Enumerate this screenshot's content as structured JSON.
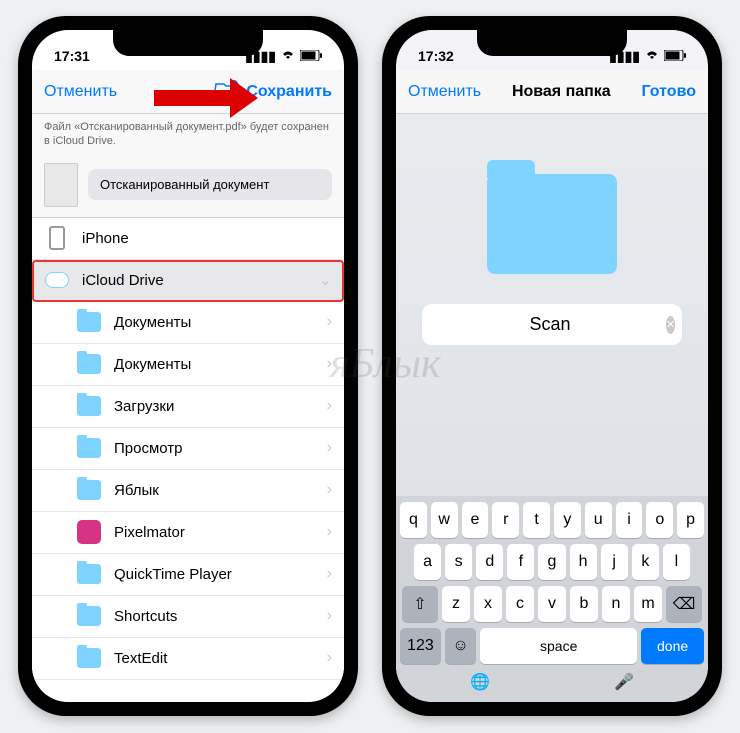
{
  "watermark": "яБлык",
  "left": {
    "status": {
      "time": "17:31"
    },
    "nav": {
      "cancel": "Отменить",
      "save": "Сохранить"
    },
    "subtext": "Файл «Отсканированный документ.pdf» будет сохранен в iCloud Drive.",
    "doc_name": "Отсканированный документ",
    "locations": {
      "iphone": "iPhone",
      "icloud": "iCloud Drive"
    },
    "folders": [
      "Документы",
      "Документы",
      "Загрузки",
      "Просмотр",
      "Яблык",
      "Pixelmator",
      "QuickTime Player",
      "Shortcuts",
      "TextEdit"
    ]
  },
  "right": {
    "status": {
      "time": "17:32"
    },
    "nav": {
      "cancel": "Отменить",
      "title": "Новая папка",
      "done": "Готово"
    },
    "input": {
      "value": "Scan"
    },
    "keyboard": {
      "row1": [
        "q",
        "w",
        "e",
        "r",
        "t",
        "y",
        "u",
        "i",
        "o",
        "p"
      ],
      "row2": [
        "a",
        "s",
        "d",
        "f",
        "g",
        "h",
        "j",
        "k",
        "l"
      ],
      "row3": [
        "z",
        "x",
        "c",
        "v",
        "b",
        "n",
        "m"
      ],
      "numkey": "123",
      "space": "space",
      "done": "done"
    }
  }
}
